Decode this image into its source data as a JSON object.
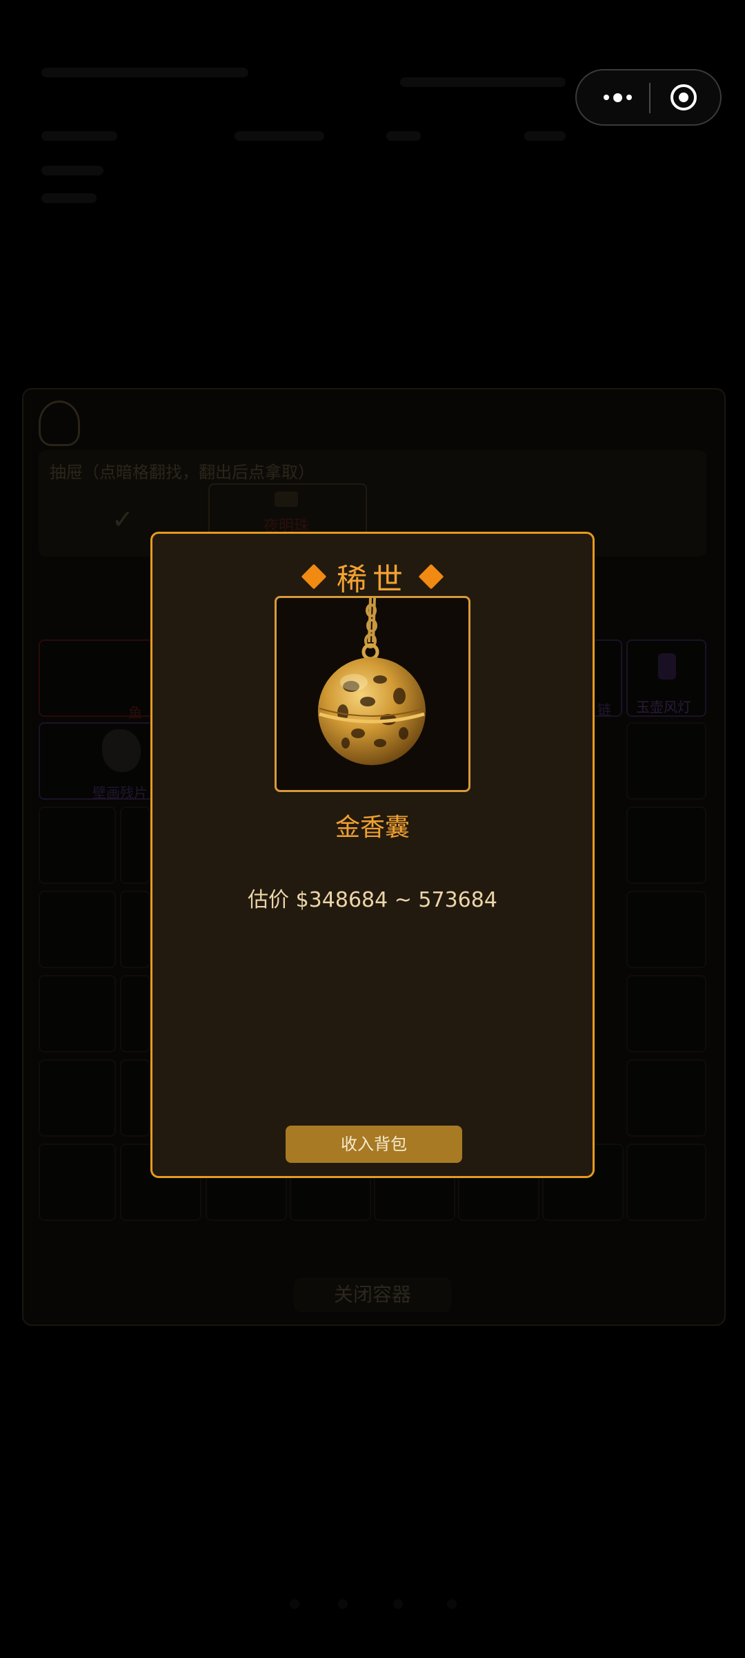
{
  "capsule": {
    "more_icon": "more-dots-icon",
    "close_icon": "target-circle-icon"
  },
  "container": {
    "drawer_title": "抽屉（点暗格翻找，翻出后点拿取）",
    "drawer_check": "✓",
    "drawer_item_label": "夜明珠",
    "grid_labels": {
      "fish": "鱼",
      "mural": "壁画残片",
      "chain": "链",
      "lantern": "玉壶风灯"
    },
    "close_label": "关闭容器"
  },
  "modal": {
    "rarity": "稀世",
    "item_name": "金香囊",
    "price": "估价 $348684 ~ 573684",
    "collect_label": "收入背包",
    "accent_color": "#e79a1f"
  }
}
